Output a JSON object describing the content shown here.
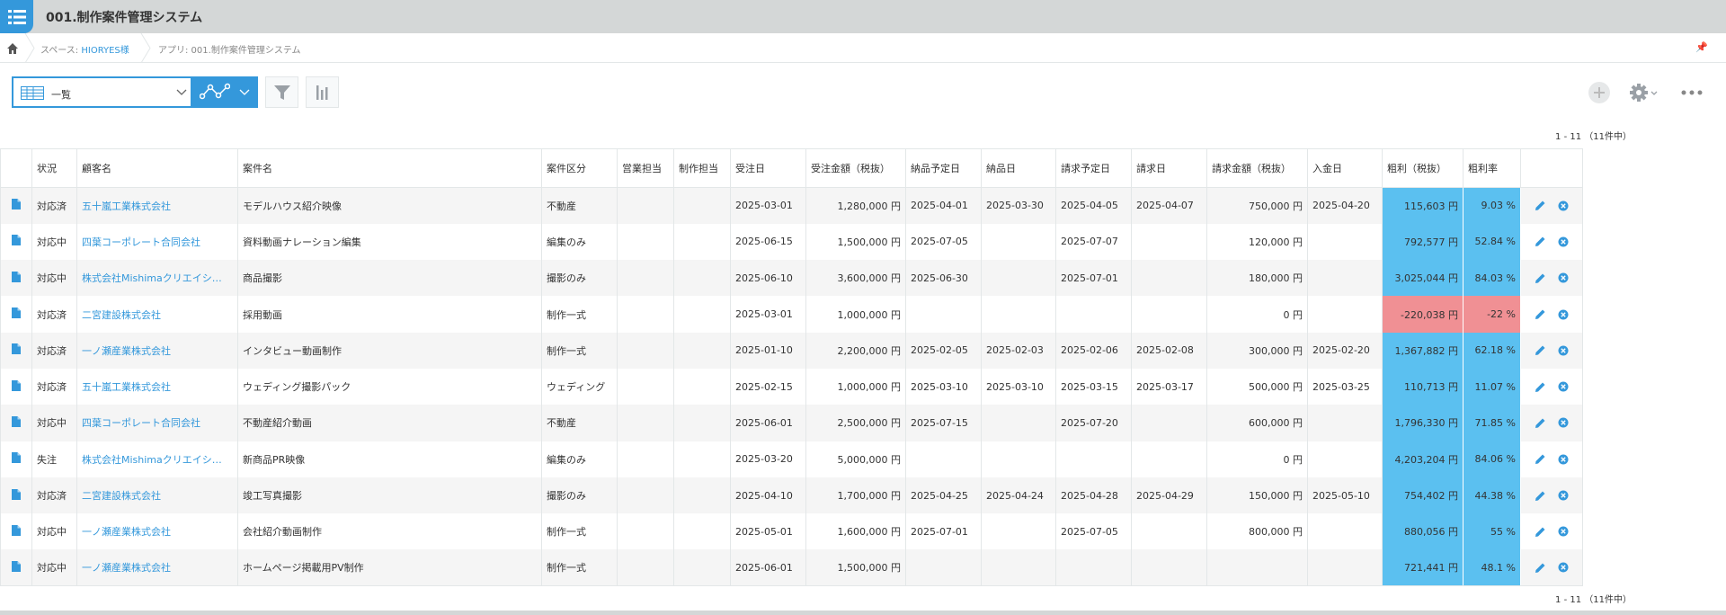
{
  "header": {
    "title": "001.制作案件管理システム"
  },
  "breadcrumb": {
    "space_prefix": "スペース: ",
    "space_name": "HIORYES様",
    "app_label": "アプリ: 001.制作案件管理システム"
  },
  "toolbar": {
    "view_label": "一覧"
  },
  "pager": {
    "text": "1 - 11 （11件中）"
  },
  "table": {
    "columns": [
      "",
      "状況",
      "顧客名",
      "案件名",
      "案件区分",
      "営業担当",
      "制作担当",
      "受注日",
      "受注金額（税抜）",
      "納品予定日",
      "納品日",
      "請求予定日",
      "請求日",
      "請求金額（税抜）",
      "入金日",
      "粗利（税抜）",
      "粗利率",
      ""
    ],
    "rows": [
      [
        "対応済",
        "五十嵐工業株式会社",
        "モデルハウス紹介映像",
        "不動産",
        "",
        "",
        "2025-03-01",
        "1,280,000 円",
        "2025-04-01",
        "2025-03-30",
        "2025-04-05",
        "2025-04-07",
        "750,000 円",
        "2025-04-20",
        "115,603 円",
        "9.03 %"
      ],
      [
        "対応中",
        "四葉コーポレート合同会社",
        "資料動画ナレーション編集",
        "編集のみ",
        "",
        "",
        "2025-06-15",
        "1,500,000 円",
        "2025-07-05",
        "",
        "2025-07-07",
        "",
        "120,000 円",
        "",
        "792,577 円",
        "52.84 %"
      ],
      [
        "対応中",
        "株式会社Mishimaクリエイシ…",
        "商品撮影",
        "撮影のみ",
        "",
        "",
        "2025-06-10",
        "3,600,000 円",
        "2025-06-30",
        "",
        "2025-07-01",
        "",
        "180,000 円",
        "",
        "3,025,044 円",
        "84.03 %"
      ],
      [
        "対応済",
        "二宮建設株式会社",
        "採用動画",
        "制作一式",
        "",
        "",
        "2025-03-01",
        "1,000,000 円",
        "",
        "",
        "",
        "",
        "0 円",
        "",
        "-220,038 円",
        "-22 %"
      ],
      [
        "対応済",
        "一ノ瀬産業株式会社",
        "インタビュー動画制作",
        "制作一式",
        "",
        "",
        "2025-01-10",
        "2,200,000 円",
        "2025-02-05",
        "2025-02-03",
        "2025-02-06",
        "2025-02-08",
        "300,000 円",
        "2025-02-20",
        "1,367,882 円",
        "62.18 %"
      ],
      [
        "対応済",
        "五十嵐工業株式会社",
        "ウェディング撮影パック",
        "ウェディング",
        "",
        "",
        "2025-02-15",
        "1,000,000 円",
        "2025-03-10",
        "2025-03-10",
        "2025-03-15",
        "2025-03-17",
        "500,000 円",
        "2025-03-25",
        "110,713 円",
        "11.07 %"
      ],
      [
        "対応中",
        "四葉コーポレート合同会社",
        "不動産紹介動画",
        "不動産",
        "",
        "",
        "2025-06-01",
        "2,500,000 円",
        "2025-07-15",
        "",
        "2025-07-20",
        "",
        "600,000 円",
        "",
        "1,796,330 円",
        "71.85 %"
      ],
      [
        "失注",
        "株式会社Mishimaクリエイシ…",
        "新商品PR映像",
        "編集のみ",
        "",
        "",
        "2025-03-20",
        "5,000,000 円",
        "",
        "",
        "",
        "",
        "0 円",
        "",
        "4,203,204 円",
        "84.06 %"
      ],
      [
        "対応済",
        "二宮建設株式会社",
        "竣工写真撮影",
        "撮影のみ",
        "",
        "",
        "2025-04-10",
        "1,700,000 円",
        "2025-04-25",
        "2025-04-24",
        "2025-04-28",
        "2025-04-29",
        "150,000 円",
        "2025-05-10",
        "754,402 円",
        "44.38 %"
      ],
      [
        "対応中",
        "一ノ瀬産業株式会社",
        "会社紹介動画制作",
        "制作一式",
        "",
        "",
        "2025-05-01",
        "1,600,000 円",
        "2025-07-01",
        "",
        "2025-07-05",
        "",
        "800,000 円",
        "",
        "880,056 円",
        "55 %"
      ],
      [
        "対応中",
        "一ノ瀬産業株式会社",
        "ホームページ掲載用PV制作",
        "制作一式",
        "",
        "",
        "2025-06-01",
        "1,500,000 円",
        "",
        "",
        "",
        "",
        "",
        "",
        "721,441 円",
        "48.1 %"
      ]
    ],
    "negative_rows": [
      3
    ]
  },
  "colors": {
    "accent": "#3498db",
    "positive_cell": "#5bc0f0",
    "negative_cell": "#f09094"
  },
  "icons": [
    "menu-icon",
    "home-icon",
    "pin-icon",
    "table-view-icon",
    "chevron-down-icon",
    "graph-icon",
    "filter-icon",
    "bar-chart-icon",
    "plus-icon",
    "gear-icon",
    "more-icon",
    "record-file-icon",
    "edit-pencil-icon",
    "delete-circle-icon"
  ]
}
